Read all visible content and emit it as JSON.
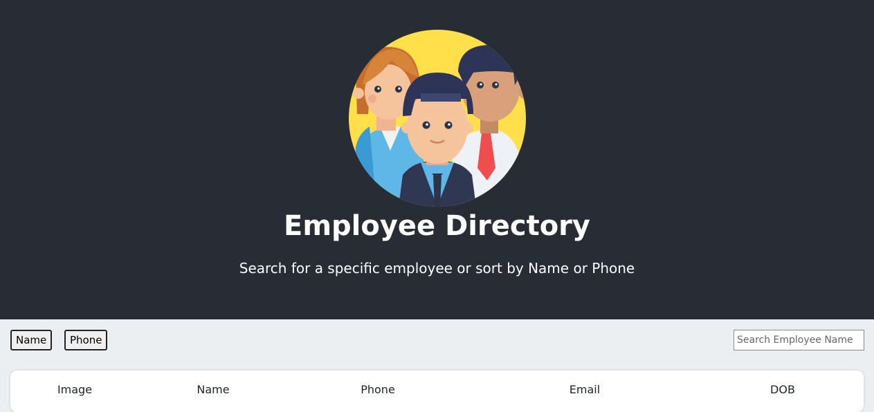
{
  "header": {
    "title": "Employee Directory",
    "subtitle": "Search for a specific employee or sort by Name or Phone",
    "logo_icon": "employees-group-icon"
  },
  "controls": {
    "sort_name_label": "Name",
    "sort_phone_label": "Phone",
    "search_placeholder": "Search Employee Name"
  },
  "table": {
    "columns": [
      "Image",
      "Name",
      "Phone",
      "Email",
      "DOB"
    ]
  },
  "colors": {
    "hero_bg": "#282c34",
    "page_bg": "#eceff1",
    "logo_circle": "#ffe04b"
  }
}
